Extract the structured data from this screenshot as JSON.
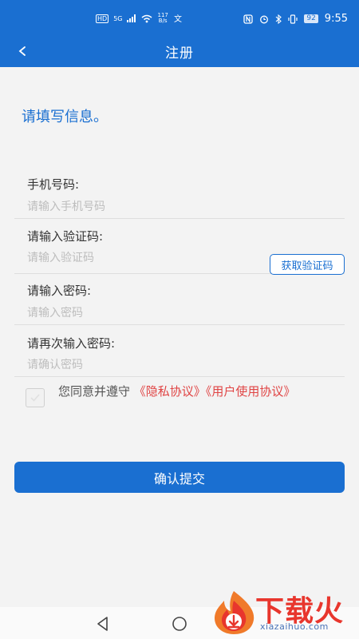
{
  "status_bar": {
    "hd": "HD",
    "network": "5G",
    "speed_value": "117",
    "speed_unit": "B/s",
    "battery": "92",
    "time": "9:55"
  },
  "header": {
    "back_label": "<",
    "title": "注册"
  },
  "intro": "请填写信息。",
  "form": {
    "phone": {
      "label": "手机号码:",
      "placeholder": "请输入手机号码"
    },
    "code": {
      "label": "请输入验证码:",
      "placeholder": "请输入验证码",
      "button_label": "获取验证码"
    },
    "password": {
      "label": "请输入密码:",
      "placeholder": "请输入密码"
    },
    "confirm": {
      "label": "请再次输入密码:",
      "placeholder": "请确认密码"
    }
  },
  "agreement": {
    "checked": false,
    "text": "您同意并遵守",
    "privacy_link": "《隐私协议》",
    "user_link": "《用户使用协议》"
  },
  "submit_label": "确认提交",
  "watermark": {
    "title": "下载火",
    "url": "xiazaihuo.com"
  },
  "colors": {
    "primary": "#1a6fd1",
    "link": "#e04444",
    "placeholder": "#bdbdbd",
    "background": "#f3f3f3"
  },
  "icons": {
    "back": "chevron-left-icon",
    "nav_back": "triangle-back-icon",
    "nav_home": "circle-home-icon",
    "check": "check-icon"
  }
}
